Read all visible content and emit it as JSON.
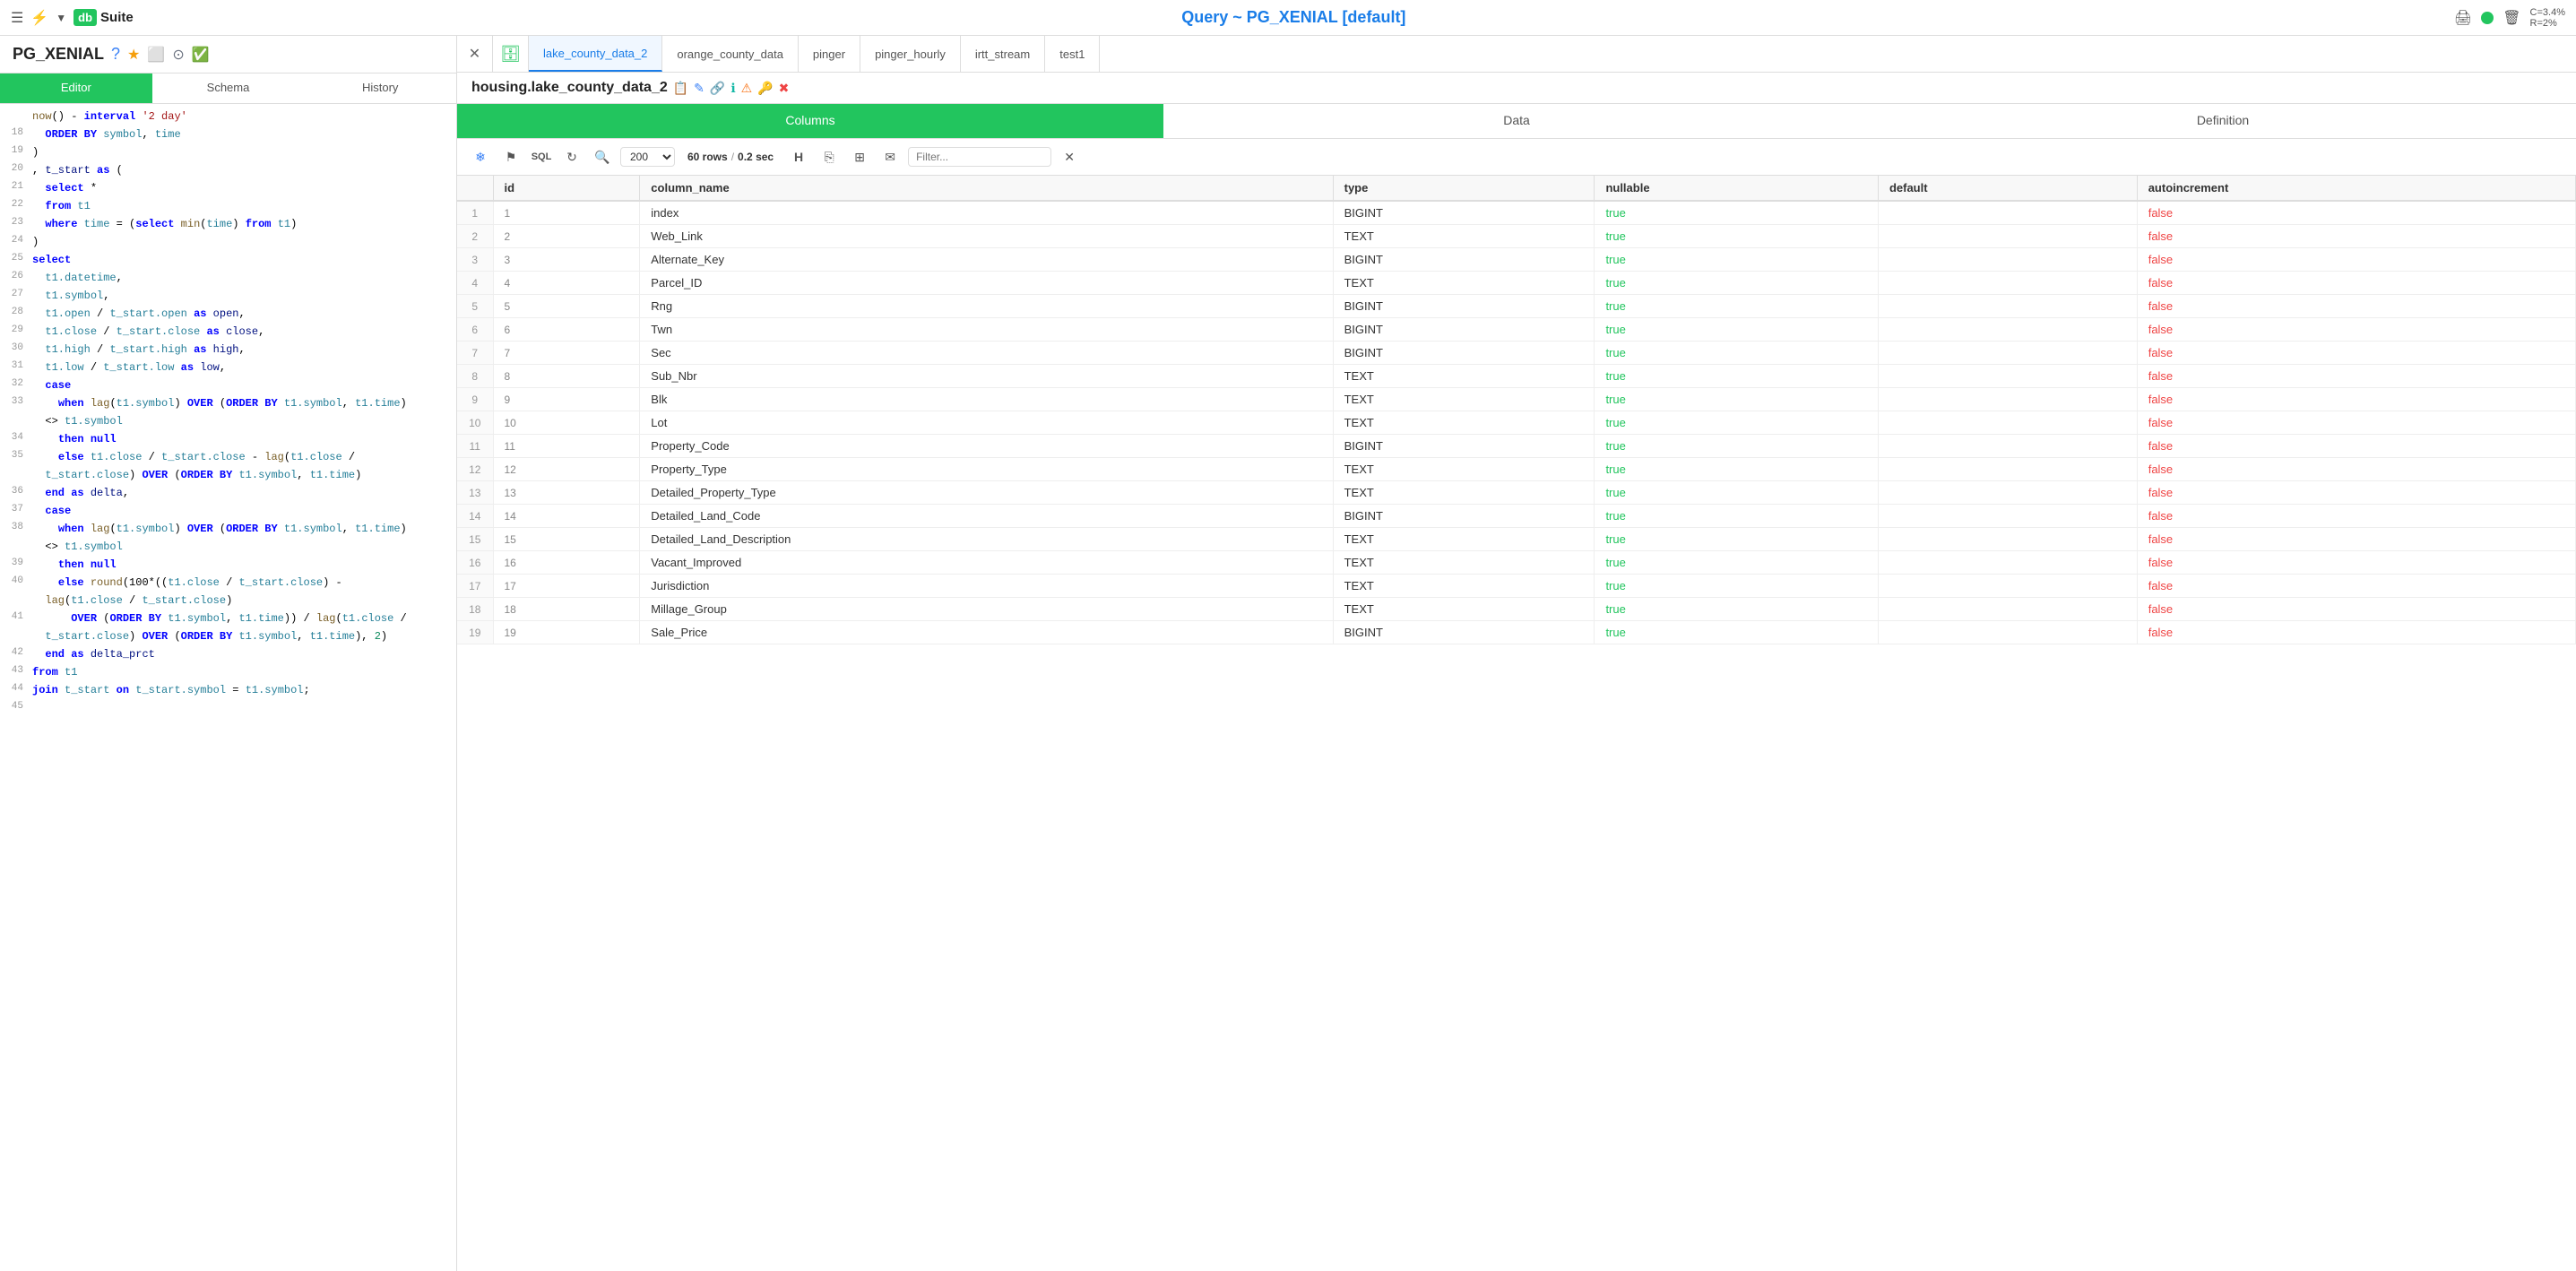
{
  "topbar": {
    "title": "Query ~ PG_XENIAL [default]",
    "stats": "C=3.4%\nR=2%"
  },
  "left_panel": {
    "db_name": "PG_XENIAL",
    "tabs": [
      "Editor",
      "Schema",
      "History"
    ],
    "active_tab": "Editor"
  },
  "right_panel": {
    "query_tabs": [
      {
        "label": "lake_county_data_2",
        "active": true
      },
      {
        "label": "orange_county_data",
        "active": false
      },
      {
        "label": "pinger",
        "active": false
      },
      {
        "label": "pinger_hourly",
        "active": false
      },
      {
        "label": "irtt_stream",
        "active": false
      },
      {
        "label": "test1",
        "active": false
      }
    ],
    "table_title": "housing.lake_county_data_2",
    "panel_tabs": [
      "Columns",
      "Data",
      "Definition"
    ],
    "active_panel_tab": "Columns",
    "toolbar": {
      "rows_label": "60 rows",
      "time_label": "0.2 sec",
      "rows_value": "200",
      "filter_placeholder": "Filter..."
    },
    "columns": {
      "headers": [
        "",
        "id",
        "column_name",
        "type",
        "nullable",
        "default",
        "autoincrement"
      ],
      "rows": [
        {
          "row": 1,
          "id": 1,
          "column_name": "index",
          "type": "BIGINT",
          "nullable": "true",
          "default": "",
          "autoincrement": "false"
        },
        {
          "row": 2,
          "id": 2,
          "column_name": "Web_Link",
          "type": "TEXT",
          "nullable": "true",
          "default": "",
          "autoincrement": "false"
        },
        {
          "row": 3,
          "id": 3,
          "column_name": "Alternate_Key",
          "type": "BIGINT",
          "nullable": "true",
          "default": "",
          "autoincrement": "false"
        },
        {
          "row": 4,
          "id": 4,
          "column_name": "Parcel_ID",
          "type": "TEXT",
          "nullable": "true",
          "default": "",
          "autoincrement": "false"
        },
        {
          "row": 5,
          "id": 5,
          "column_name": "Rng",
          "type": "BIGINT",
          "nullable": "true",
          "default": "",
          "autoincrement": "false"
        },
        {
          "row": 6,
          "id": 6,
          "column_name": "Twn",
          "type": "BIGINT",
          "nullable": "true",
          "default": "",
          "autoincrement": "false"
        },
        {
          "row": 7,
          "id": 7,
          "column_name": "Sec",
          "type": "BIGINT",
          "nullable": "true",
          "default": "",
          "autoincrement": "false"
        },
        {
          "row": 8,
          "id": 8,
          "column_name": "Sub_Nbr",
          "type": "TEXT",
          "nullable": "true",
          "default": "",
          "autoincrement": "false"
        },
        {
          "row": 9,
          "id": 9,
          "column_name": "Blk",
          "type": "TEXT",
          "nullable": "true",
          "default": "",
          "autoincrement": "false"
        },
        {
          "row": 10,
          "id": 10,
          "column_name": "Lot",
          "type": "TEXT",
          "nullable": "true",
          "default": "",
          "autoincrement": "false"
        },
        {
          "row": 11,
          "id": 11,
          "column_name": "Property_Code",
          "type": "BIGINT",
          "nullable": "true",
          "default": "",
          "autoincrement": "false"
        },
        {
          "row": 12,
          "id": 12,
          "column_name": "Property_Type",
          "type": "TEXT",
          "nullable": "true",
          "default": "",
          "autoincrement": "false"
        },
        {
          "row": 13,
          "id": 13,
          "column_name": "Detailed_Property_Type",
          "type": "TEXT",
          "nullable": "true",
          "default": "",
          "autoincrement": "false"
        },
        {
          "row": 14,
          "id": 14,
          "column_name": "Detailed_Land_Code",
          "type": "BIGINT",
          "nullable": "true",
          "default": "",
          "autoincrement": "false"
        },
        {
          "row": 15,
          "id": 15,
          "column_name": "Detailed_Land_Description",
          "type": "TEXT",
          "nullable": "true",
          "default": "",
          "autoincrement": "false"
        },
        {
          "row": 16,
          "id": 16,
          "column_name": "Vacant_Improved",
          "type": "TEXT",
          "nullable": "true",
          "default": "",
          "autoincrement": "false"
        },
        {
          "row": 17,
          "id": 17,
          "column_name": "Jurisdiction",
          "type": "TEXT",
          "nullable": "true",
          "default": "",
          "autoincrement": "false"
        },
        {
          "row": 18,
          "id": 18,
          "column_name": "Millage_Group",
          "type": "TEXT",
          "nullable": "true",
          "default": "",
          "autoincrement": "false"
        },
        {
          "row": 19,
          "id": 19,
          "column_name": "Sale_Price",
          "type": "BIGINT",
          "nullable": "true",
          "default": "",
          "autoincrement": "false"
        }
      ]
    }
  }
}
